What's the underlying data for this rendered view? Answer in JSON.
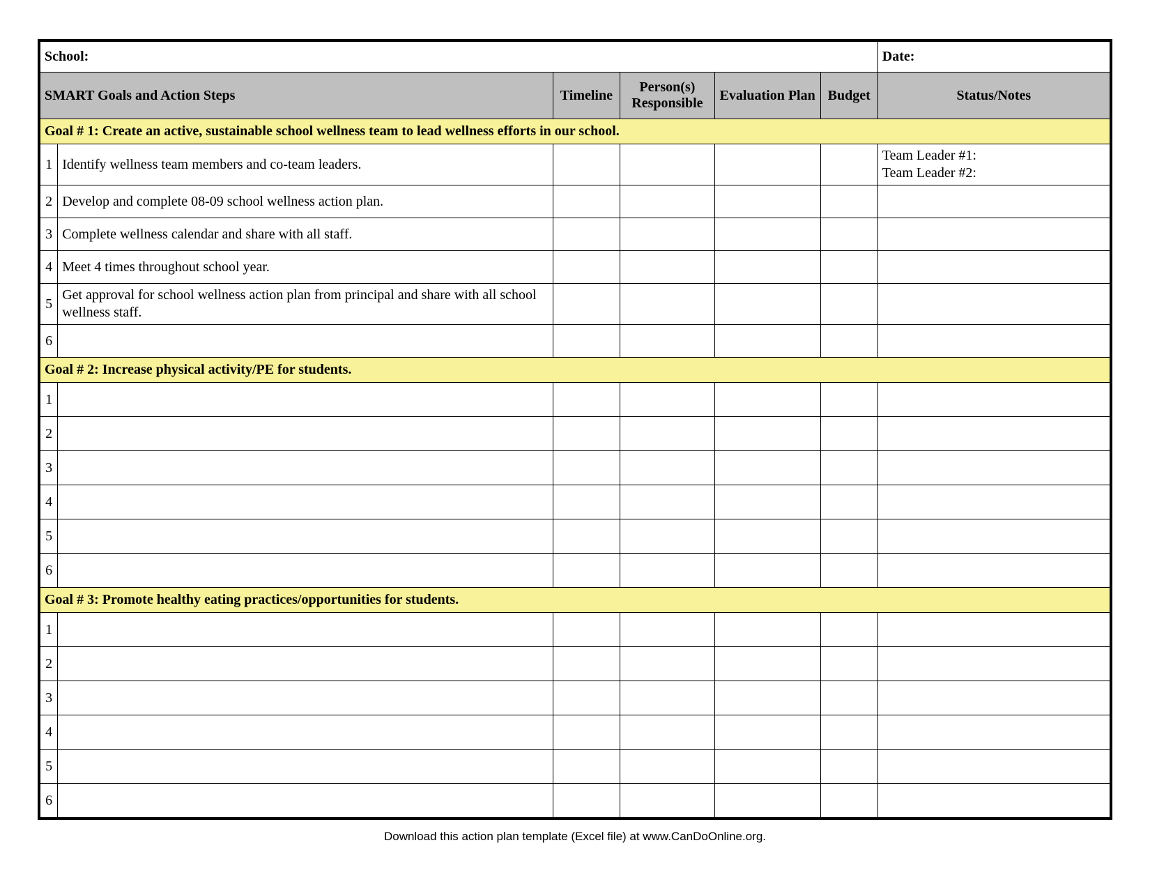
{
  "info": {
    "school_label": "School:",
    "date_label": "Date:"
  },
  "columns": {
    "smart": "SMART Goals and Action Steps",
    "timeline": "Timeline",
    "persons": "Person(s) Responsible",
    "eval": "Evaluation Plan",
    "budget": "Budget",
    "status": "Status/Notes"
  },
  "goals": [
    {
      "title": "Goal # 1: Create an active, sustainable school wellness team to lead wellness efforts in our school.",
      "rows": [
        {
          "n": "1",
          "step": "Identify wellness team members and co-team leaders.",
          "timeline": "",
          "persons": "",
          "eval": "",
          "budget": "",
          "notes": "Team Leader #1:\nTeam Leader #2:"
        },
        {
          "n": "2",
          "step": "Develop and complete 08-09 school wellness action plan.",
          "timeline": "",
          "persons": "",
          "eval": "",
          "budget": "",
          "notes": ""
        },
        {
          "n": "3",
          "step": "Complete wellness calendar and share with all staff.",
          "timeline": "",
          "persons": "",
          "eval": "",
          "budget": "",
          "notes": ""
        },
        {
          "n": "4",
          "step": "Meet 4 times throughout school year.",
          "timeline": "",
          "persons": "",
          "eval": "",
          "budget": "",
          "notes": ""
        },
        {
          "n": "5",
          "step": "Get approval for school wellness action plan from principal and share with all school wellness staff.",
          "timeline": "",
          "persons": "",
          "eval": "",
          "budget": "",
          "notes": ""
        },
        {
          "n": "6",
          "step": "",
          "timeline": "",
          "persons": "",
          "eval": "",
          "budget": "",
          "notes": ""
        }
      ]
    },
    {
      "title": "Goal # 2: Increase physical activity/PE for students.",
      "rows": [
        {
          "n": "1",
          "step": "",
          "timeline": "",
          "persons": "",
          "eval": "",
          "budget": "",
          "notes": ""
        },
        {
          "n": "2",
          "step": "",
          "timeline": "",
          "persons": "",
          "eval": "",
          "budget": "",
          "notes": ""
        },
        {
          "n": "3",
          "step": "",
          "timeline": "",
          "persons": "",
          "eval": "",
          "budget": "",
          "notes": ""
        },
        {
          "n": "4",
          "step": "",
          "timeline": "",
          "persons": "",
          "eval": "",
          "budget": "",
          "notes": ""
        },
        {
          "n": "5",
          "step": "",
          "timeline": "",
          "persons": "",
          "eval": "",
          "budget": "",
          "notes": ""
        },
        {
          "n": "6",
          "step": "",
          "timeline": "",
          "persons": "",
          "eval": "",
          "budget": "",
          "notes": ""
        }
      ]
    },
    {
      "title": "Goal # 3: Promote healthy eating practices/opportunities for students.",
      "rows": [
        {
          "n": "1",
          "step": "",
          "timeline": "",
          "persons": "",
          "eval": "",
          "budget": "",
          "notes": ""
        },
        {
          "n": "2",
          "step": "",
          "timeline": "",
          "persons": "",
          "eval": "",
          "budget": "",
          "notes": ""
        },
        {
          "n": "3",
          "step": "",
          "timeline": "",
          "persons": "",
          "eval": "",
          "budget": "",
          "notes": ""
        },
        {
          "n": "4",
          "step": "",
          "timeline": "",
          "persons": "",
          "eval": "",
          "budget": "",
          "notes": ""
        },
        {
          "n": "5",
          "step": "",
          "timeline": "",
          "persons": "",
          "eval": "",
          "budget": "",
          "notes": ""
        },
        {
          "n": "6",
          "step": "",
          "timeline": "",
          "persons": "",
          "eval": "",
          "budget": "",
          "notes": ""
        }
      ]
    }
  ],
  "footer": "Download this action plan template (Excel file) at www.CanDoOnline.org."
}
